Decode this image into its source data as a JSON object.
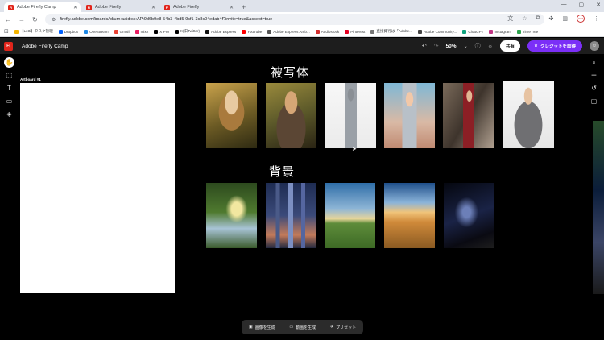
{
  "browser": {
    "tabs": [
      {
        "label": "Adobe Firefly Camp",
        "active": true
      },
      {
        "label": "Adobe Firefly",
        "active": false
      },
      {
        "label": "Adobe Firefly",
        "active": false
      }
    ],
    "url": "firefly.adobe.com/boards/id/urn:aaid:sc:AP:9d6b9e8-54b3-4bd5-9cf1-3c8c04edab4f?invite=true&accept=true",
    "bookmarks": [
      {
        "label": "【Lotti】タスク管理",
        "color": "#f4b400"
      },
      {
        "label": "Dropbox",
        "color": "#0061fe"
      },
      {
        "label": "OneStream",
        "color": "#1e88e5"
      },
      {
        "label": "Gmail",
        "color": "#ea4335"
      },
      {
        "label": "mix2",
        "color": "#e91e63"
      },
      {
        "label": "X Pro",
        "color": "#000000"
      },
      {
        "label": "X(旧Twitter)",
        "color": "#000000"
      },
      {
        "label": "Adobe Express",
        "color": "#111111"
      },
      {
        "label": "YouTube",
        "color": "#ff0000"
      },
      {
        "label": "Adobe Express Amb...",
        "color": "#555555"
      },
      {
        "label": "Audiostock",
        "color": "#d32f2f"
      },
      {
        "label": "Pinterest",
        "color": "#e60023"
      },
      {
        "label": "直接発行は「Adobe...",
        "color": "#777777"
      },
      {
        "label": "Adobe Community...",
        "color": "#444444"
      },
      {
        "label": "ChatGPT",
        "color": "#10a37f"
      },
      {
        "label": "Instagram",
        "color": "#c13584"
      },
      {
        "label": "TimeTree",
        "color": "#2ea44f"
      }
    ]
  },
  "app": {
    "logo_text": "Fi",
    "title": "Adobe Firefly Camp",
    "zoom": "50%",
    "share_label": "共有",
    "credit_label": "クレジットを取得"
  },
  "canvas": {
    "artboard_label": "Artboard #1",
    "subject_title": "被写体",
    "background_title": "背景"
  },
  "bottom_bar": {
    "generate_image": "画像を生成",
    "generate_video": "動画を生成",
    "presets": "プリセット"
  }
}
